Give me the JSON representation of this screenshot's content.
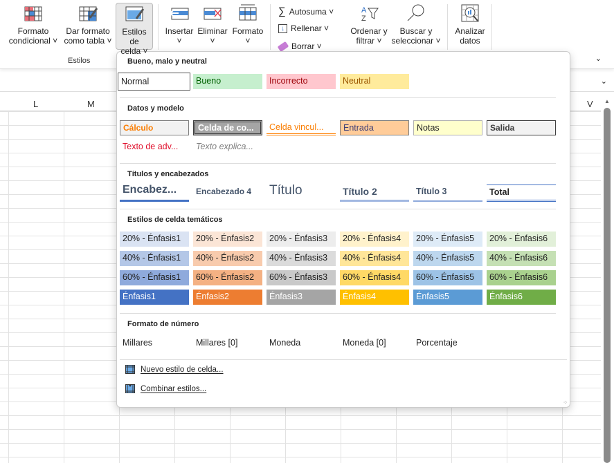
{
  "ribbon": {
    "conditional_format": {
      "l1": "Formato",
      "l2": "condicional ˅"
    },
    "format_table": {
      "l1": "Dar formato",
      "l2": "como tabla ˅"
    },
    "cell_styles": {
      "l1": "Estilos de",
      "l2": "celda ˅"
    },
    "insert": {
      "l1": "Insertar",
      "l2": "˅"
    },
    "delete": {
      "l1": "Eliminar",
      "l2": "˅"
    },
    "format": {
      "l1": "Formato",
      "l2": "˅"
    },
    "autosum": "Autosuma ˅",
    "fill": "Rellenar ˅",
    "clear": "Borrar ˅",
    "sort": {
      "l1": "Ordenar y",
      "l2": "filtrar ˅"
    },
    "find": {
      "l1": "Buscar y",
      "l2": "seleccionar ˅"
    },
    "analyze": {
      "l1": "Analizar",
      "l2": "datos"
    },
    "group_label": "Estilos"
  },
  "columns": {
    "l": "L",
    "m": "M",
    "v": "V"
  },
  "panel": {
    "s1": "Bueno, malo y neutral",
    "good_bad": [
      "Normal",
      "Bueno",
      "Incorrecto",
      "Neutral"
    ],
    "s2": "Datos y modelo",
    "data_model": [
      "Cálculo",
      "Celda de co...",
      "Celda vincul...",
      "Entrada",
      "Notas",
      "Salida",
      "Texto de adv...",
      "Texto explica..."
    ],
    "s3": "Títulos y encabezados",
    "titles": [
      "Encabez...",
      "Encabezado 4",
      "Título",
      "Título 2",
      "Título 3",
      "Total"
    ],
    "s4": "Estilos de celda temáticos",
    "themed": [
      [
        "20% - Énfasis1",
        "20% - Énfasis2",
        "20% - Énfasis3",
        "20% - Énfasis4",
        "20% - Énfasis5",
        "20% - Énfasis6"
      ],
      [
        "40% - Énfasis1",
        "40% - Énfasis2",
        "40% - Énfasis3",
        "40% - Énfasis4",
        "40% - Énfasis5",
        "40% - Énfasis6"
      ],
      [
        "60% - Énfasis1",
        "60% - Énfasis2",
        "60% - Énfasis3",
        "60% - Énfasis4",
        "60% - Énfasis5",
        "60% - Énfasis6"
      ],
      [
        "Énfasis1",
        "Énfasis2",
        "Énfasis3",
        "Énfasis4",
        "Énfasis5",
        "Énfasis6"
      ]
    ],
    "themed_colors": [
      [
        "#dae3f3",
        "#fbe5d6",
        "#ededed",
        "#fff2cc",
        "#deebf7",
        "#e2f0d9"
      ],
      [
        "#b4c7e7",
        "#f8cbad",
        "#dbdbdb",
        "#ffe699",
        "#bdd7ee",
        "#c5e0b4"
      ],
      [
        "#8faadc",
        "#f4b183",
        "#c9c9c9",
        "#ffd966",
        "#9dc3e6",
        "#a9d18e"
      ],
      [
        "#4472c4",
        "#ed7d31",
        "#a5a5a5",
        "#ffc000",
        "#5b9bd5",
        "#70ad47"
      ]
    ],
    "s5": "Formato de número",
    "number": [
      "Millares",
      "Millares [0]",
      "Moneda",
      "Moneda [0]",
      "Porcentaje"
    ],
    "new_style": "Nuevo estilo de celda...",
    "merge_styles": "Combinar estilos..."
  }
}
